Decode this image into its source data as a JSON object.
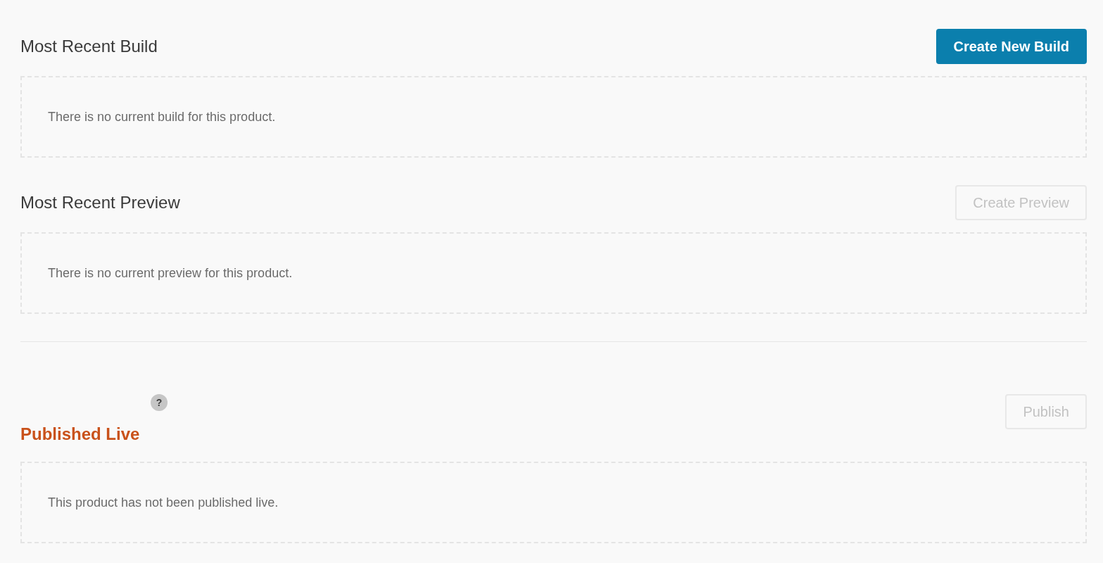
{
  "groups": [
    {
      "sections": [
        {
          "kind": "plain",
          "title": "Most Recent Build",
          "button": {
            "label": "Create New Build",
            "kind": "primary",
            "disabled": false
          },
          "message": "There is no current build for this product."
        },
        {
          "kind": "plain",
          "title": "Most Recent Preview",
          "button": {
            "label": "Create Preview",
            "kind": "secondary",
            "disabled": true
          },
          "message": "There is no current preview for this product."
        }
      ]
    },
    {
      "sections": [
        {
          "kind": "highlighted",
          "help": "?",
          "title": "Published Live",
          "button": {
            "label": "Publish",
            "kind": "secondary",
            "disabled": true
          },
          "message": "This product has not been published live."
        }
      ]
    }
  ]
}
